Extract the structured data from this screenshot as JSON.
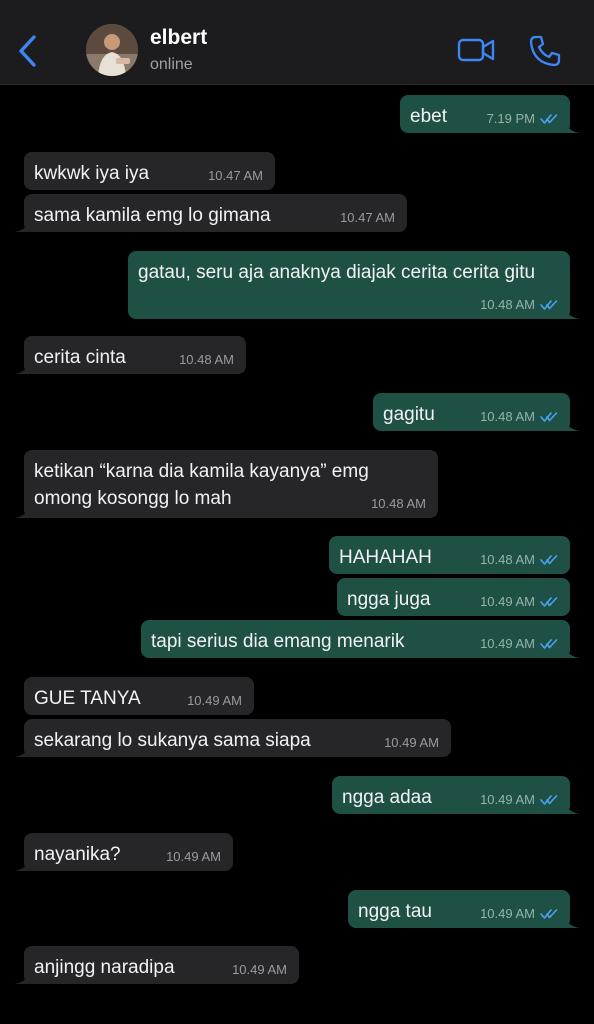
{
  "header": {
    "contact_name": "elbert",
    "status": "online",
    "icons": {
      "back": "chevron-left-icon",
      "video": "video-camera-icon",
      "call": "phone-icon"
    },
    "accent_color": "#3d86f5"
  },
  "colors": {
    "incoming_bubble": "#262628",
    "outgoing_bubble": "#1f5046",
    "read_ticks": "#4aa3f0"
  },
  "messages": [
    {
      "dir": "out",
      "text": "ebet",
      "time": "7.19 PM"
    },
    {
      "dir": "in",
      "text": "kwkwk iya iya",
      "time": "10.47 AM"
    },
    {
      "dir": "in",
      "text": "sama kamila emg lo gimana",
      "time": "10.47 AM"
    },
    {
      "dir": "out",
      "text": "gatau, seru aja anaknya diajak cerita cerita gitu",
      "time": "10.48 AM"
    },
    {
      "dir": "in",
      "text": "cerita cinta",
      "time": "10.48 AM"
    },
    {
      "dir": "out",
      "text": "gagitu",
      "time": "10.48 AM"
    },
    {
      "dir": "in",
      "text": "ketikan “karna dia kamila kayanya” emg omong kosongg lo mah",
      "time": "10.48 AM"
    },
    {
      "dir": "out",
      "text": "HAHAHAH",
      "time": "10.48 AM"
    },
    {
      "dir": "out",
      "text": "ngga juga",
      "time": "10.49 AM"
    },
    {
      "dir": "out",
      "text": "tapi serius dia emang menarik",
      "time": "10.49 AM"
    },
    {
      "dir": "in",
      "text": "GUE TANYA",
      "time": "10.49 AM"
    },
    {
      "dir": "in",
      "text": "sekarang lo sukanya sama siapa",
      "time": "10.49 AM"
    },
    {
      "dir": "out",
      "text": "ngga adaa",
      "time": "10.49 AM"
    },
    {
      "dir": "in",
      "text": "nayanika?",
      "time": "10.49 AM"
    },
    {
      "dir": "out",
      "text": "ngga tau",
      "time": "10.49 AM"
    },
    {
      "dir": "in",
      "text": "anjingg naradipa",
      "time": "10.49 AM"
    }
  ]
}
